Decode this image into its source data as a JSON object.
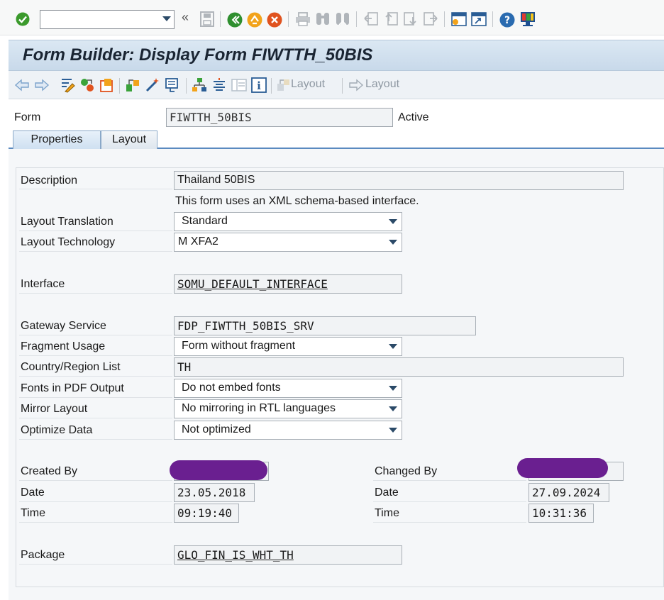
{
  "toolbar": {
    "command_placeholder": "",
    "icons": [
      "enter-icon",
      "back-icon",
      "exit-icon",
      "cancel-icon",
      "print-icon",
      "find-icon",
      "find-next-icon",
      "first-page-icon",
      "previous-page-icon",
      "next-page-icon",
      "last-page-icon",
      "create-session-icon",
      "shortcut-icon",
      "help-icon",
      "customize-layout-icon"
    ],
    "colors": {
      "enter": "#3b9a2c",
      "back": "#2f8f2f",
      "exit": "#f2a31b",
      "cancel": "#e0531f",
      "help": "#2a6bb0"
    }
  },
  "title": "Form Builder: Display Form FIWTTH_50BIS",
  "app_toolbar": {
    "layout_label_1": "Layout",
    "layout_label_2": "Layout"
  },
  "form": {
    "label": "Form",
    "name": "FIWTTH_50BIS",
    "status": "Active"
  },
  "tabs": [
    {
      "label": "Properties",
      "active": true
    },
    {
      "label": "Layout",
      "active": false
    }
  ],
  "properties": {
    "description_label": "Description",
    "description_value": "Thailand 50BIS",
    "interface_note": "This form uses an XML schema-based interface.",
    "layout_translation_label": "Layout Translation",
    "layout_translation_value": "Standard",
    "layout_technology_label": "Layout Technology",
    "layout_technology_value": "M XFA2",
    "interface_label": "Interface",
    "interface_value": "SOMU_DEFAULT_INTERFACE",
    "gateway_label": "Gateway Service",
    "gateway_value": "FDP_FIWTTH_50BIS_SRV",
    "fragment_label": "Fragment Usage",
    "fragment_value": "Form without fragment",
    "country_label": "Country/Region List",
    "country_value": "TH",
    "fonts_label": "Fonts in PDF Output",
    "fonts_value": "Do not embed fonts",
    "mirror_label": "Mirror Layout",
    "mirror_value": "No mirroring in RTL languages",
    "optimize_label": "Optimize Data",
    "optimize_value": "Not optimized",
    "created_by_label": "Created By",
    "changed_by_label": "Changed By",
    "date_label": "Date",
    "time_label": "Time",
    "created_date": "23.05.2018",
    "created_time": "09:19:40",
    "changed_date": "27.09.2024",
    "changed_time": "10:31:36",
    "package_label": "Package",
    "package_value": "GLO_FIN_IS_WHT_TH",
    "redaction_color": "#6a1f90"
  }
}
